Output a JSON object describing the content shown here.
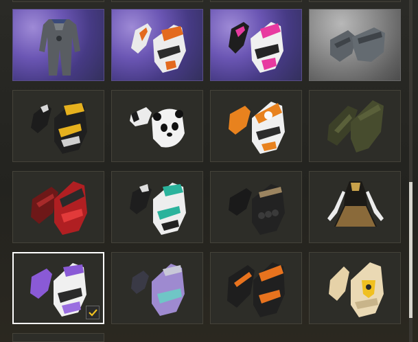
{
  "inventory": {
    "items": [
      {
        "name": "tracksuit-outfit-icon",
        "style": "epic"
      },
      {
        "name": "orange-racing-gloves-icon",
        "style": "epic"
      },
      {
        "name": "pink-racing-gloves-icon",
        "style": "epic"
      },
      {
        "name": "gray-fingerless-gloves-icon",
        "style": "silver"
      },
      {
        "name": "yellow-black-gloves-icon",
        "style": "normal"
      },
      {
        "name": "panda-gloves-icon",
        "style": "normal"
      },
      {
        "name": "orange-white-gloves-icon",
        "style": "normal"
      },
      {
        "name": "olive-leather-gloves-icon",
        "style": "normal"
      },
      {
        "name": "red-racing-gloves-icon",
        "style": "normal"
      },
      {
        "name": "teal-white-gloves-icon",
        "style": "normal"
      },
      {
        "name": "black-knuckle-gloves-icon",
        "style": "normal"
      },
      {
        "name": "black-gold-dress-icon",
        "style": "normal"
      },
      {
        "name": "purple-white-gloves-icon",
        "style": "normal",
        "selected": true
      },
      {
        "name": "purple-teal-gloves-icon",
        "style": "normal"
      },
      {
        "name": "orange-black-gloves-icon",
        "style": "normal"
      },
      {
        "name": "beige-emblem-gloves-icon",
        "style": "normal"
      }
    ],
    "selected_index": 12,
    "scrollbar": {
      "position_fraction": 0.53
    }
  },
  "colors": {
    "background": "#23231f",
    "tile": "#2d2d28",
    "epic": "#6b56b4",
    "silver": "#8c8c8c",
    "selection": "#ffffff",
    "check": "#f0c020"
  }
}
